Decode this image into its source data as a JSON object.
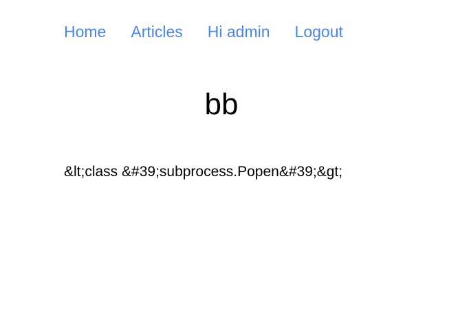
{
  "nav": {
    "items": [
      {
        "label": "Home"
      },
      {
        "label": "Articles"
      },
      {
        "label": "Hi admin"
      },
      {
        "label": "Logout"
      }
    ],
    "link_color": "#4a86e8"
  },
  "article": {
    "title": "bb",
    "body": "&lt;class &#39;subprocess.Popen&#39;&gt;"
  }
}
